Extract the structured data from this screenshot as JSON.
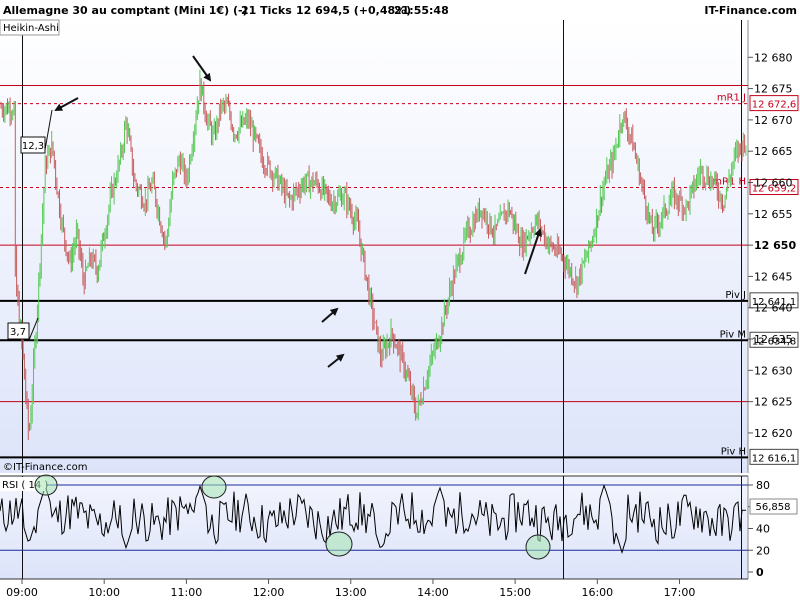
{
  "header": {
    "title": "Allemagne 30 au comptant (Mini 1€) (-)",
    "ticks": "21 Ticks",
    "price": "12 694,5 (+0,48%)",
    "time": "21:55:48",
    "brand": "IT-Finance.com"
  },
  "chart_type_label": "Heikin-Ashi",
  "watermark": "©IT-Finance.com",
  "annotations": {
    "box1": "12,3",
    "box2": "3,7"
  },
  "rsi": {
    "label": "RSI ( 14 )",
    "value_label": "56,858",
    "ticks": [
      "80",
      "60",
      "40",
      "20",
      "0"
    ]
  },
  "x_ticks": [
    "09:00",
    "10:00",
    "11:00",
    "12:00",
    "13:00",
    "14:00",
    "15:00",
    "16:00",
    "17:00"
  ],
  "colors": {
    "up": "#56c956",
    "down": "#c65c5c",
    "level_red": "#c4001b",
    "bg_top": "#ffffff",
    "bg_bottom": "#dde4fa",
    "accent_circle": "#a6e5b2"
  },
  "chart_data": {
    "type": "line",
    "title": "Allemagne 30 au comptant (Mini 1€) (-)",
    "ylim": [
      12615,
      12685
    ],
    "y_ticks": [
      12680,
      12675,
      12670,
      12665,
      12660,
      12655,
      12650,
      12645,
      12640,
      12635,
      12630,
      12625,
      12620
    ],
    "y_tick_labels": [
      "12 680",
      "12 675",
      "12 670",
      "12 665",
      "12 660",
      "12 655",
      "12 650",
      "12 645",
      "12 640",
      "12 635",
      "12 630",
      "12 625",
      "12 620"
    ],
    "levels": [
      {
        "name": "",
        "value": 12675.5,
        "style": "solid",
        "color": "red"
      },
      {
        "name": "mR1 J",
        "value": 12672.6,
        "label": "12 672,6",
        "style": "dashed",
        "color": "red"
      },
      {
        "name": "mR1 H",
        "value": 12659.2,
        "label": "12 659,2",
        "style": "dashed",
        "color": "red"
      },
      {
        "name": "",
        "value": 12650.0,
        "style": "solid",
        "color": "red"
      },
      {
        "name": "Piv J",
        "value": 12641.1,
        "label": "12 641,1",
        "style": "solid",
        "color": "black"
      },
      {
        "name": "Piv M",
        "value": 12634.8,
        "label": "12 634,8",
        "style": "solid",
        "color": "black"
      },
      {
        "name": "",
        "value": 12625.0,
        "style": "solid",
        "color": "red"
      },
      {
        "name": "Piv H",
        "value": 12616.1,
        "label": "12 616,1",
        "style": "solid",
        "color": "black"
      }
    ],
    "x_range": [
      "08:55",
      "17:50"
    ],
    "vertical_markers": [
      "09:00",
      "15:35",
      "17:45"
    ],
    "price_path": [
      [
        "08:55",
        12644
      ],
      [
        "09:00",
        12634
      ],
      [
        "09:05",
        12619
      ],
      [
        "09:10",
        12636
      ],
      [
        "09:17",
        12663
      ],
      [
        "09:22",
        12666
      ],
      [
        "09:25",
        12660
      ],
      [
        "09:30",
        12652
      ],
      [
        "09:35",
        12647
      ],
      [
        "09:40",
        12652
      ],
      [
        "09:45",
        12644
      ],
      [
        "09:50",
        12648
      ],
      [
        "09:55",
        12646
      ],
      [
        "10:00",
        12652
      ],
      [
        "10:05",
        12658
      ],
      [
        "10:12",
        12664
      ],
      [
        "10:16",
        12670
      ],
      [
        "10:22",
        12660
      ],
      [
        "10:30",
        12657
      ],
      [
        "10:35",
        12660
      ],
      [
        "10:40",
        12655
      ],
      [
        "10:45",
        12650
      ],
      [
        "10:50",
        12660
      ],
      [
        "10:55",
        12664
      ],
      [
        "11:00",
        12660
      ],
      [
        "11:05",
        12668
      ],
      [
        "11:10",
        12676
      ],
      [
        "11:15",
        12670
      ],
      [
        "11:20",
        12667
      ],
      [
        "11:25",
        12672
      ],
      [
        "11:30",
        12672
      ],
      [
        "11:35",
        12668
      ],
      [
        "11:45",
        12670
      ],
      [
        "11:55",
        12664
      ],
      [
        "12:05",
        12661
      ],
      [
        "12:15",
        12657
      ],
      [
        "12:25",
        12660
      ],
      [
        "12:35",
        12660
      ],
      [
        "12:45",
        12657
      ],
      [
        "12:55",
        12658
      ],
      [
        "13:05",
        12653
      ],
      [
        "13:15",
        12640
      ],
      [
        "13:22",
        12632
      ],
      [
        "13:30",
        12636
      ],
      [
        "13:40",
        12630
      ],
      [
        "13:48",
        12623
      ],
      [
        "13:55",
        12629
      ],
      [
        "14:05",
        12636
      ],
      [
        "14:15",
        12645
      ],
      [
        "14:25",
        12652
      ],
      [
        "14:35",
        12656
      ],
      [
        "14:45",
        12652
      ],
      [
        "14:55",
        12656
      ],
      [
        "15:05",
        12650
      ],
      [
        "15:15",
        12654
      ],
      [
        "15:25",
        12650
      ],
      [
        "15:35",
        12648
      ],
      [
        "15:45",
        12644
      ],
      [
        "15:55",
        12650
      ],
      [
        "16:05",
        12660
      ],
      [
        "16:12",
        12664
      ],
      [
        "16:18",
        12671
      ],
      [
        "16:25",
        12667
      ],
      [
        "16:32",
        12660
      ],
      [
        "16:40",
        12652
      ],
      [
        "16:48",
        12655
      ],
      [
        "16:55",
        12658
      ],
      [
        "17:05",
        12656
      ],
      [
        "17:15",
        12662
      ],
      [
        "17:25",
        12660
      ],
      [
        "17:32",
        12657
      ],
      [
        "17:40",
        12664
      ],
      [
        "17:48",
        12667
      ],
      [
        "17:55",
        12662
      ],
      [
        "18:05",
        12666
      ],
      [
        "18:15",
        12670
      ],
      [
        "18:25",
        12666
      ],
      [
        "18:35",
        12668
      ],
      [
        "18:45",
        12664
      ],
      [
        "18:50",
        12667
      ],
      [
        "18:55",
        12672
      ]
    ],
    "rsi_series": {
      "name": "RSI ( 14 )",
      "last": 56.858,
      "ylim": [
        0,
        80
      ],
      "levels": [
        30,
        70
      ]
    }
  }
}
